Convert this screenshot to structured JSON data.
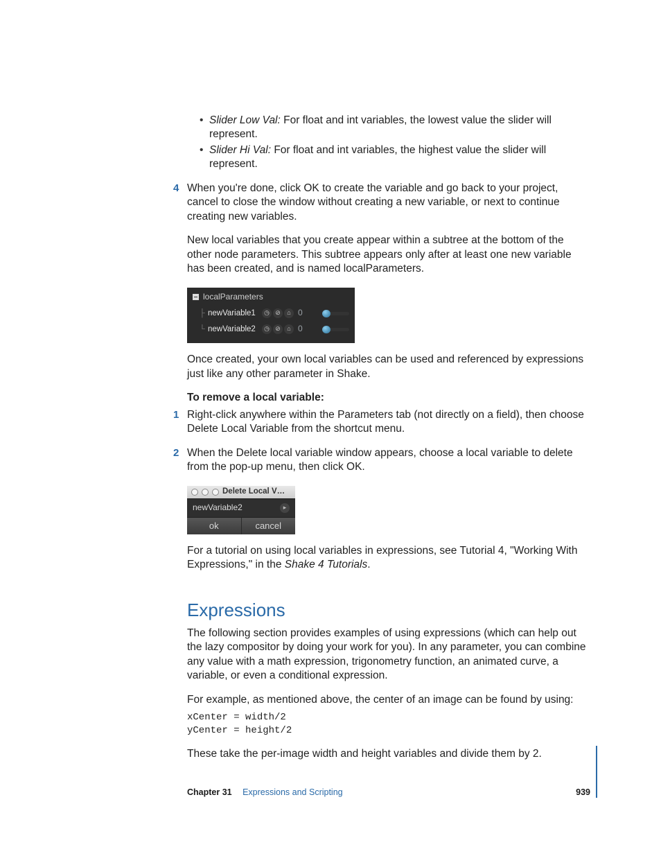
{
  "bullets": [
    {
      "term": "Slider Low Val:",
      "text": "  For float and int variables, the lowest value the slider will represent."
    },
    {
      "term": "Slider Hi Val:",
      "text": "  For float and int variables, the highest value the slider will represent."
    }
  ],
  "step4_num": "4",
  "step4": "When you're done, click OK to create the variable and go back to your project, cancel to close the window without creating a new variable, or next to continue creating new variables.",
  "para_new_local": "New local variables that you create appear within a subtree at the bottom of the other node parameters. This subtree appears only after at least one new variable has been created, and is named localParameters.",
  "panel1": {
    "head": "localParameters",
    "rows": [
      {
        "name": "newVariable1",
        "val": "0"
      },
      {
        "name": "newVariable2",
        "val": "0"
      }
    ]
  },
  "para_once": "Once created, your own local variables can be used and referenced by expressions just like any other parameter in Shake.",
  "remove_head": "To remove a local variable:",
  "step1_num": "1",
  "step1": "Right-click anywhere within the Parameters tab (not directly on a field), then choose Delete Local Variable from the shortcut menu.",
  "step2_num": "2",
  "step2": "When the Delete local variable window appears, choose a local variable to delete from the pop-up menu, then click OK.",
  "panel2": {
    "title": "Delete Local V…",
    "value": "newVariable2",
    "ok": "ok",
    "cancel": "cancel"
  },
  "para_tutorial_a": "For a tutorial on using local variables in expressions, see Tutorial 4, \"Working With Expressions,\" in the ",
  "para_tutorial_b": "Shake 4 Tutorials",
  "para_tutorial_c": ".",
  "section": "Expressions",
  "para_expr": "The following section provides examples of using expressions (which can help out the lazy compositor by doing your work for you). In any parameter, you can combine any value with a math expression, trigonometry function, an animated curve, a variable, or even a conditional expression.",
  "para_example": "For example, as mentioned above, the center of an image can be found by using:",
  "code": "xCenter = width/2\nyCenter = height/2",
  "para_take": "These take the per-image width and height variables and divide them by 2.",
  "footer": {
    "chapter": "Chapter 31",
    "title": "Expressions and Scripting",
    "page": "939"
  }
}
